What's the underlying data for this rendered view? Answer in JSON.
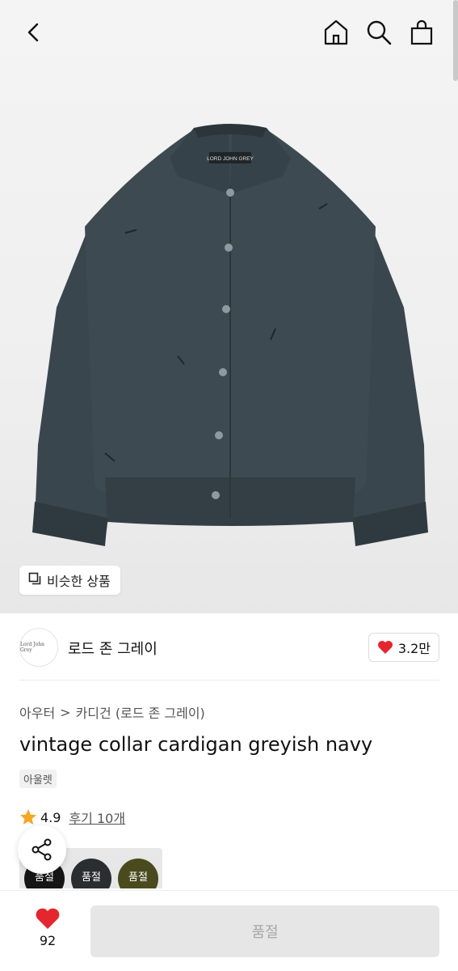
{
  "icons": {
    "back": "chevron-left-icon",
    "home": "home-icon",
    "search": "search-icon",
    "bag": "shopping-bag-icon",
    "similar": "copy-icon",
    "like": "heart-icon",
    "star": "star-icon",
    "share": "share-icon"
  },
  "hero": {
    "garment_label": "LORD JOHN GREY",
    "similar_label": "비슷한 상품"
  },
  "brand": {
    "logo_text": "Lord John Grey",
    "name": "로드 존 그레이",
    "like_count": "3.2만"
  },
  "breadcrumb": {
    "category": "아우터",
    "separator": ">",
    "subcategory": "카디건 (로드 존 그레이)"
  },
  "product": {
    "title": "vintage collar cardigan greyish navy",
    "tag": "아울렛"
  },
  "rating": {
    "score": "4.9",
    "reviews": "후기 10개"
  },
  "swatches": [
    {
      "label": "품절"
    },
    {
      "label": "품절"
    },
    {
      "label": "품절"
    }
  ],
  "bottom": {
    "wish_count": "92",
    "buy_label": "품절"
  },
  "colors": {
    "heart": "#e5262e",
    "star": "#f5a623",
    "garment": "#3d4a51",
    "buy_disabled_bg": "#e6e6e6"
  }
}
